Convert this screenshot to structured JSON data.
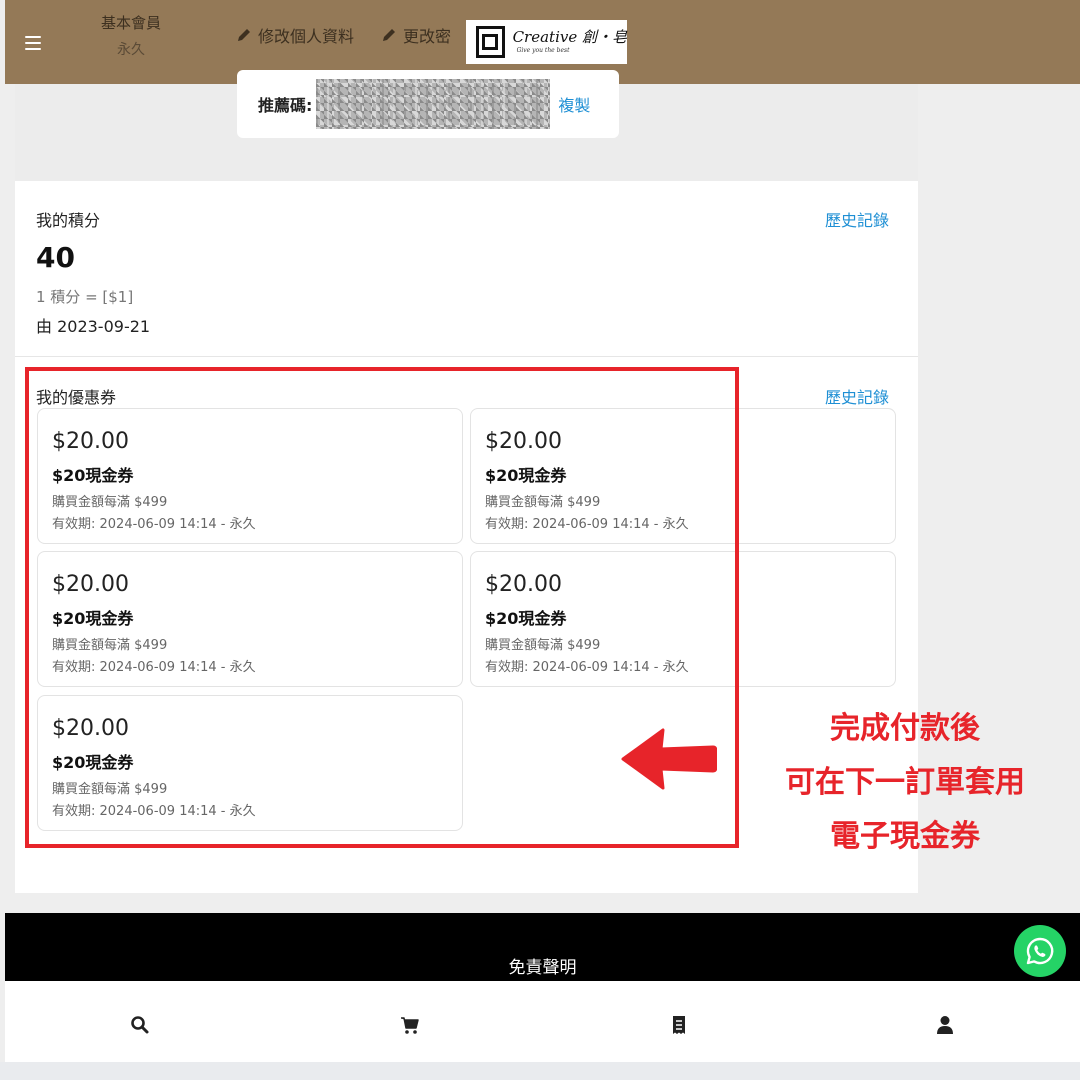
{
  "header": {
    "member_level": "基本會員",
    "member_term": "永久",
    "edit_profile": "修改個人資料",
    "change_password": "更改密",
    "logo_text": "Creative 創・皂",
    "logo_sub": "Give you the best",
    "bg_color": "#947957"
  },
  "referral": {
    "label": "推薦碼:",
    "copy_label": "複製"
  },
  "points": {
    "title": "我的積分",
    "history": "歷史記錄",
    "value": "40",
    "rate": "1 積分 = [$1]",
    "since": "由 2023-09-21"
  },
  "coupons": {
    "title": "我的優惠券",
    "history": "歷史記錄",
    "items": [
      {
        "amount": "$20.00",
        "name": "$20現金券",
        "min_spend": "購買金額每滿 $499",
        "validity": "有效期: 2024-06-09 14:14 - 永久"
      },
      {
        "amount": "$20.00",
        "name": "$20現金券",
        "min_spend": "購買金額每滿 $499",
        "validity": "有效期: 2024-06-09 14:14 - 永久"
      },
      {
        "amount": "$20.00",
        "name": "$20現金券",
        "min_spend": "購買金額每滿 $499",
        "validity": "有效期: 2024-06-09 14:14 - 永久"
      },
      {
        "amount": "$20.00",
        "name": "$20現金券",
        "min_spend": "購買金額每滿 $499",
        "validity": "有效期: 2024-06-09 14:14 - 永久"
      },
      {
        "amount": "$20.00",
        "name": "$20現金券",
        "min_spend": "購買金額每滿 $499",
        "validity": "有效期: 2024-06-09 14:14 - 永久"
      }
    ]
  },
  "annotation": {
    "line1": "完成付款後",
    "line2": "可在下一訂單套用",
    "line3": "電子現金券",
    "color": "#e7242a"
  },
  "footer": {
    "disclaimer": "免責聲明"
  },
  "bottom_nav": {
    "items": [
      "search-icon",
      "cart-icon",
      "receipt-icon",
      "user-icon"
    ]
  }
}
